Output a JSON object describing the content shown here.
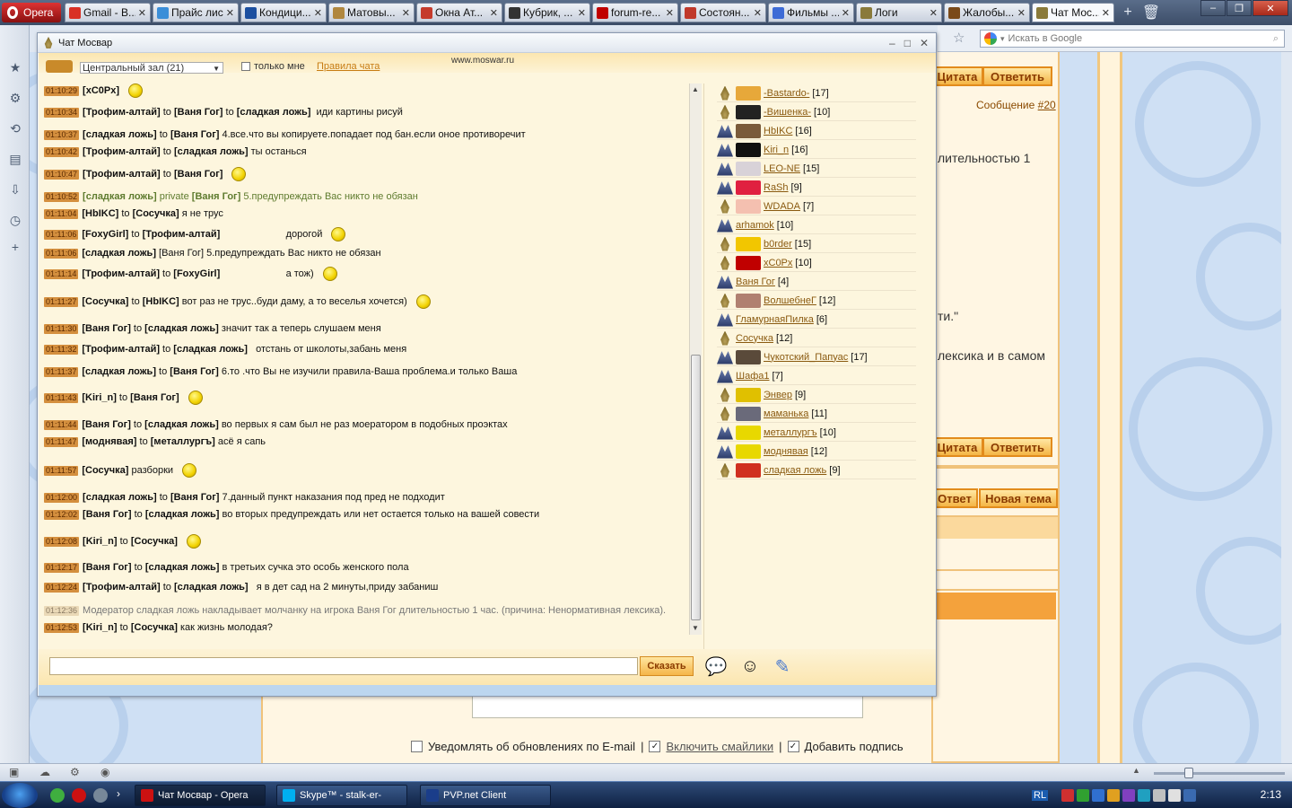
{
  "browser": {
    "opera_label": "Opera",
    "tabs": [
      {
        "title": "Gmail - В...",
        "color": "#d93025"
      },
      {
        "title": "Прайс лист",
        "color": "#3b8ed8"
      },
      {
        "title": "Кондици...",
        "color": "#1c4fa0"
      },
      {
        "title": "Матовы...",
        "color": "#b0873f"
      },
      {
        "title": "Окна Ат...",
        "color": "#c53b2c"
      },
      {
        "title": "Кубрик, ...",
        "color": "#333333"
      },
      {
        "title": "forum-re...",
        "color": "#c00000"
      },
      {
        "title": "Состоян...",
        "color": "#c0392b"
      },
      {
        "title": "Фильмы ...",
        "color": "#3d6bd6"
      },
      {
        "title": "Логи",
        "color": "#8a7a3a"
      },
      {
        "title": "Жалобы...",
        "color": "#7a4a1a"
      },
      {
        "title": "Чат Мос...",
        "color": "#8a7a3a"
      }
    ],
    "search_placeholder": "Искать в Google"
  },
  "chat_window": {
    "title": "Чат Мосвар",
    "url": "www.moswar.ru",
    "room": "Центральный зал (21)",
    "only_me": "только мне",
    "rules": "Правила чата"
  },
  "messages": [
    {
      "time": "01:10:29",
      "parts": [
        {
          "t": "[хС0Рх]",
          "b": true
        }
      ],
      "smile": true
    },
    {
      "time": "01:10:34",
      "parts": [
        {
          "t": "[Трофим-алтай]",
          "b": true
        },
        {
          "t": " to "
        },
        {
          "t": "[Ваня Гог]",
          "b": true
        },
        {
          "t": " to "
        },
        {
          "t": "[сладкая ложь]",
          "b": true
        },
        {
          "t": "  иди картины рисуй"
        }
      ],
      "smile": false
    },
    {
      "time": "01:10:37",
      "parts": [
        {
          "t": "[сладкая ложь]",
          "b": true
        },
        {
          "t": " to "
        },
        {
          "t": "[Ваня Гог]",
          "b": true
        },
        {
          "t": " 4.все.что вы копируете.попадает под бан.если оное противоречит"
        }
      ]
    },
    {
      "time": "01:10:42",
      "parts": [
        {
          "t": "[Трофим-алтай]",
          "b": true
        },
        {
          "t": " to "
        },
        {
          "t": "[сладкая ложь]",
          "b": true
        },
        {
          "t": " ты останься"
        }
      ]
    },
    {
      "time": "01:10:47",
      "parts": [
        {
          "t": "[Трофим-алтай]",
          "b": true
        },
        {
          "t": " to "
        },
        {
          "t": "[Ваня Гог]",
          "b": true
        }
      ],
      "smile": true
    },
    {
      "time": "01:10:52",
      "parts": [
        {
          "t": "[сладкая ложь]",
          "b": true,
          "c": "priv"
        },
        {
          "t": " private ",
          "c": "priv"
        },
        {
          "t": "[Ваня Гог]",
          "b": true,
          "c": "priv"
        },
        {
          "t": " 5.предупреждать Вас никто не обязан",
          "c": "priv"
        }
      ]
    },
    {
      "time": "01:11:04",
      "parts": [
        {
          "t": "[HbIKC]",
          "b": true
        },
        {
          "t": " to "
        },
        {
          "t": "[Сосучка]",
          "b": true
        },
        {
          "t": " я не трус"
        }
      ]
    },
    {
      "time": "01:11:06",
      "parts": [
        {
          "t": "[FoxyGirl]",
          "b": true
        },
        {
          "t": " to "
        },
        {
          "t": "[Трофим-алтай]",
          "b": true
        },
        {
          "t": "                        дорогой"
        }
      ],
      "smile": true
    },
    {
      "time": "01:11:06",
      "parts": [
        {
          "t": "[сладкая ложь]",
          "b": true
        },
        {
          "t": " [Ваня Гог] 5.предупреждать Вас никто не обязан"
        }
      ]
    },
    {
      "time": "01:11:14",
      "parts": [
        {
          "t": "[Трофим-алтай]",
          "b": true
        },
        {
          "t": " to "
        },
        {
          "t": "[FoxyGirl]",
          "b": true
        },
        {
          "t": "                        а тож)"
        }
      ],
      "smile": true
    },
    {
      "time": "01:11:27",
      "parts": [
        {
          "t": "[Сосучка]",
          "b": true
        },
        {
          "t": " to "
        },
        {
          "t": "[HbIKC]",
          "b": true
        },
        {
          "t": " вот раз не трус..буди даму, а то веселья хочется)"
        }
      ],
      "smile": true
    },
    {
      "time": "01:11:30",
      "parts": [
        {
          "t": "[Ваня Гог]",
          "b": true
        },
        {
          "t": " to "
        },
        {
          "t": "[сладкая ложь]",
          "b": true
        },
        {
          "t": " значит так а теперь слушаем меня"
        }
      ]
    },
    {
      "time": "01:11:32",
      "parts": [
        {
          "t": "[Трофим-алтай]",
          "b": true
        },
        {
          "t": " to "
        },
        {
          "t": "[сладкая ложь]",
          "b": true
        },
        {
          "t": "   отстань от школоты,забань меня"
        }
      ],
      "smile": false
    },
    {
      "time": "01:11:37",
      "parts": [
        {
          "t": "[сладкая ложь]",
          "b": true
        },
        {
          "t": " to "
        },
        {
          "t": "[Ваня Гог]",
          "b": true
        },
        {
          "t": " 6.то .что Вы не изучили правила-Ваша проблема.и только Ваша"
        }
      ]
    },
    {
      "time": "01:11:43",
      "parts": [
        {
          "t": "[Kiri_n]",
          "b": true
        },
        {
          "t": " to "
        },
        {
          "t": "[Ваня Гог]",
          "b": true
        }
      ],
      "smile": true
    },
    {
      "time": "01:11:44",
      "parts": [
        {
          "t": "[Ваня Гог]",
          "b": true
        },
        {
          "t": " to "
        },
        {
          "t": "[сладкая ложь]",
          "b": true
        },
        {
          "t": " во первых я сам был не раз моератором в подобных проэктах"
        }
      ]
    },
    {
      "time": "01:11:47",
      "parts": [
        {
          "t": "[моднявая]",
          "b": true
        },
        {
          "t": " to "
        },
        {
          "t": "[металлургъ]",
          "b": true
        },
        {
          "t": " асё я сапь"
        }
      ]
    },
    {
      "time": "01:11:57",
      "parts": [
        {
          "t": "[Сосучка]",
          "b": true
        },
        {
          "t": " разборки"
        }
      ],
      "smile": true
    },
    {
      "time": "01:12:00",
      "parts": [
        {
          "t": "[сладкая ложь]",
          "b": true
        },
        {
          "t": " to "
        },
        {
          "t": "[Ваня Гог]",
          "b": true
        },
        {
          "t": " 7.данный пункт наказания под пред не подходит"
        }
      ]
    },
    {
      "time": "01:12:02",
      "parts": [
        {
          "t": "[Ваня Гог]",
          "b": true
        },
        {
          "t": " to "
        },
        {
          "t": "[сладкая ложь]",
          "b": true
        },
        {
          "t": " во вторых предупреждать или нет остается только на вашей совести"
        }
      ]
    },
    {
      "time": "01:12:08",
      "parts": [
        {
          "t": "[Kiri_n]",
          "b": true
        },
        {
          "t": " to "
        },
        {
          "t": "[Сосучка]",
          "b": true
        }
      ],
      "smile": true
    },
    {
      "time": "01:12:17",
      "parts": [
        {
          "t": "[Ваня Гог]",
          "b": true
        },
        {
          "t": " to "
        },
        {
          "t": "[сладкая ложь]",
          "b": true
        },
        {
          "t": " в третьих сучка это особь женского пола"
        }
      ]
    },
    {
      "time": "01:12:24",
      "parts": [
        {
          "t": "[Трофим-алтай]",
          "b": true
        },
        {
          "t": " to "
        },
        {
          "t": "[сладкая ложь]",
          "b": true
        },
        {
          "t": "   я в дет сад на 2 минуты,приду забаниш"
        }
      ],
      "smile": false
    },
    {
      "time": "01:12:36",
      "muted": true,
      "parts": [
        {
          "t": "Модератор сладкая ложь накладывает молчанку на игрока Ваня Гог длительностью 1 час. (причина: Ненормативная лексика).",
          "c": "sys"
        }
      ]
    },
    {
      "time": "01:12:53",
      "parts": [
        {
          "t": "[Kiri_n]",
          "b": true
        },
        {
          "t": " to "
        },
        {
          "t": "[Сосучка]",
          "b": true
        },
        {
          "t": " как жизнь молодая?"
        }
      ]
    }
  ],
  "users": [
    {
      "name": "-Bastardo-",
      "level": "[17]",
      "rank": "drop",
      "ava": "#e7a83a"
    },
    {
      "name": "-Вишенка-",
      "level": "[10]",
      "rank": "drop",
      "ava": "#222222"
    },
    {
      "name": "HbIKC",
      "level": "[16]",
      "rank": "cap",
      "ava": "#7a5a3a"
    },
    {
      "name": "Kiri_n",
      "level": "[16]",
      "rank": "cap",
      "ava": "#111111"
    },
    {
      "name": "LEO-NE",
      "level": "[15]",
      "rank": "cap",
      "ava": "#d8d2d8"
    },
    {
      "name": "RaSh",
      "level": "[9]",
      "rank": "cap",
      "ava": "#e02040"
    },
    {
      "name": "WDADA",
      "level": "[7]",
      "rank": "drop",
      "ava": "#f4c0b0"
    },
    {
      "name": "arhamok",
      "level": "[10]",
      "rank": "cap",
      "ava": ""
    },
    {
      "name": "b0rder",
      "level": "[15]",
      "rank": "drop",
      "ava": "#f2c600"
    },
    {
      "name": "хС0Рх",
      "level": "[10]",
      "rank": "drop",
      "ava": "#c00000"
    },
    {
      "name": "Ваня Гог",
      "level": "[4]",
      "rank": "cap",
      "ava": ""
    },
    {
      "name": "ВолшебнеГ",
      "level": "[12]",
      "rank": "drop",
      "ava": "#b08070"
    },
    {
      "name": "ГламурнаяПилка",
      "level": "[6]",
      "rank": "cap",
      "ava": ""
    },
    {
      "name": "Сосучка",
      "level": "[12]",
      "rank": "drop",
      "ava": ""
    },
    {
      "name": "Чукотский_Папуас",
      "level": "[17]",
      "rank": "cap",
      "ava": "#5a4a3a"
    },
    {
      "name": "Шафа1",
      "level": "[7]",
      "rank": "cap",
      "ava": ""
    },
    {
      "name": "Энвер",
      "level": "[9]",
      "rank": "drop",
      "ava": "#e0c000"
    },
    {
      "name": "маманька",
      "level": "[11]",
      "rank": "drop",
      "ava": "#6a6a7a"
    },
    {
      "name": "металлургъ",
      "level": "[10]",
      "rank": "cap",
      "ava": "#e8d800"
    },
    {
      "name": "моднявая",
      "level": "[12]",
      "rank": "cap",
      "ava": "#e8d800"
    },
    {
      "name": "сладкая ложь",
      "level": "[9]",
      "rank": "drop",
      "ava": "#d03020"
    }
  ],
  "input": {
    "say_label": "Сказать"
  },
  "background_page": {
    "quote_label": "Цитата",
    "reply_label": "Ответить",
    "message_label": "Сообщение",
    "message_link": "#20",
    "text1": "лительностью 1",
    "text2": "ти.\"",
    "text3": "лексика и в самом",
    "answer_label": "Ответ",
    "new_topic_label": "Новая тема",
    "notify_label": "Уведомлять об обновлениях по E-mail",
    "smilies_label": "Включить смайлики",
    "signature_label": "Добавить подпись",
    "sep": "|"
  },
  "taskbar": {
    "items": [
      {
        "title": "Чат Мосвар - Opera",
        "color": "#cc1111"
      },
      {
        "title": "Skype™ - stalk-er-",
        "color": "#00aff0"
      },
      {
        "title": "PVP.net Client",
        "color": "#1a3d8a"
      }
    ],
    "lang": "RL",
    "clock": "2:13"
  }
}
